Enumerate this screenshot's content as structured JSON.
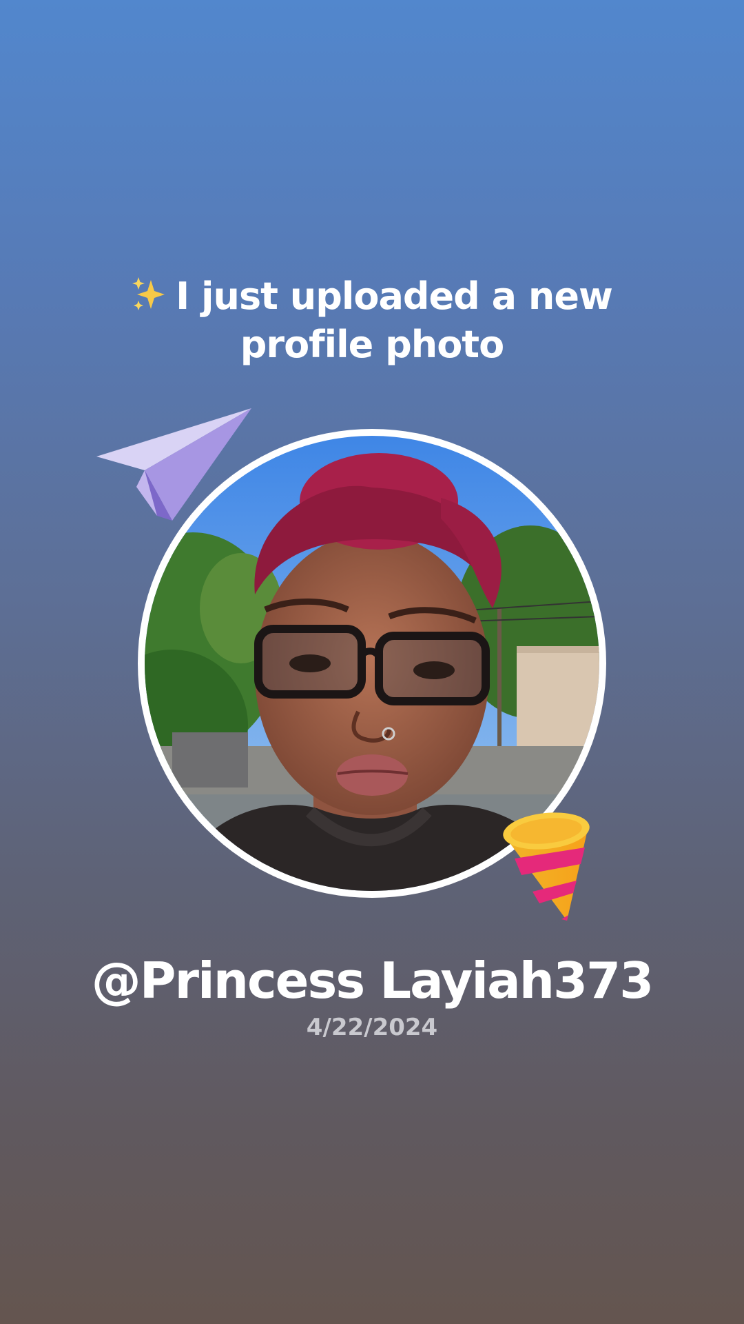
{
  "post": {
    "headline": "I just uploaded a new profile photo",
    "headline_icon": "sparkles-icon",
    "username": "@Princess Layiah373",
    "date": "4/22/2024"
  },
  "decorations": {
    "top_left": "paper-plane-icon",
    "bottom_right": "party-popper-icon"
  },
  "colors": {
    "background_top": "#5287cd",
    "background_bottom": "#64554f",
    "ring": "#ffffff",
    "date_text": "#c9c9cf"
  }
}
